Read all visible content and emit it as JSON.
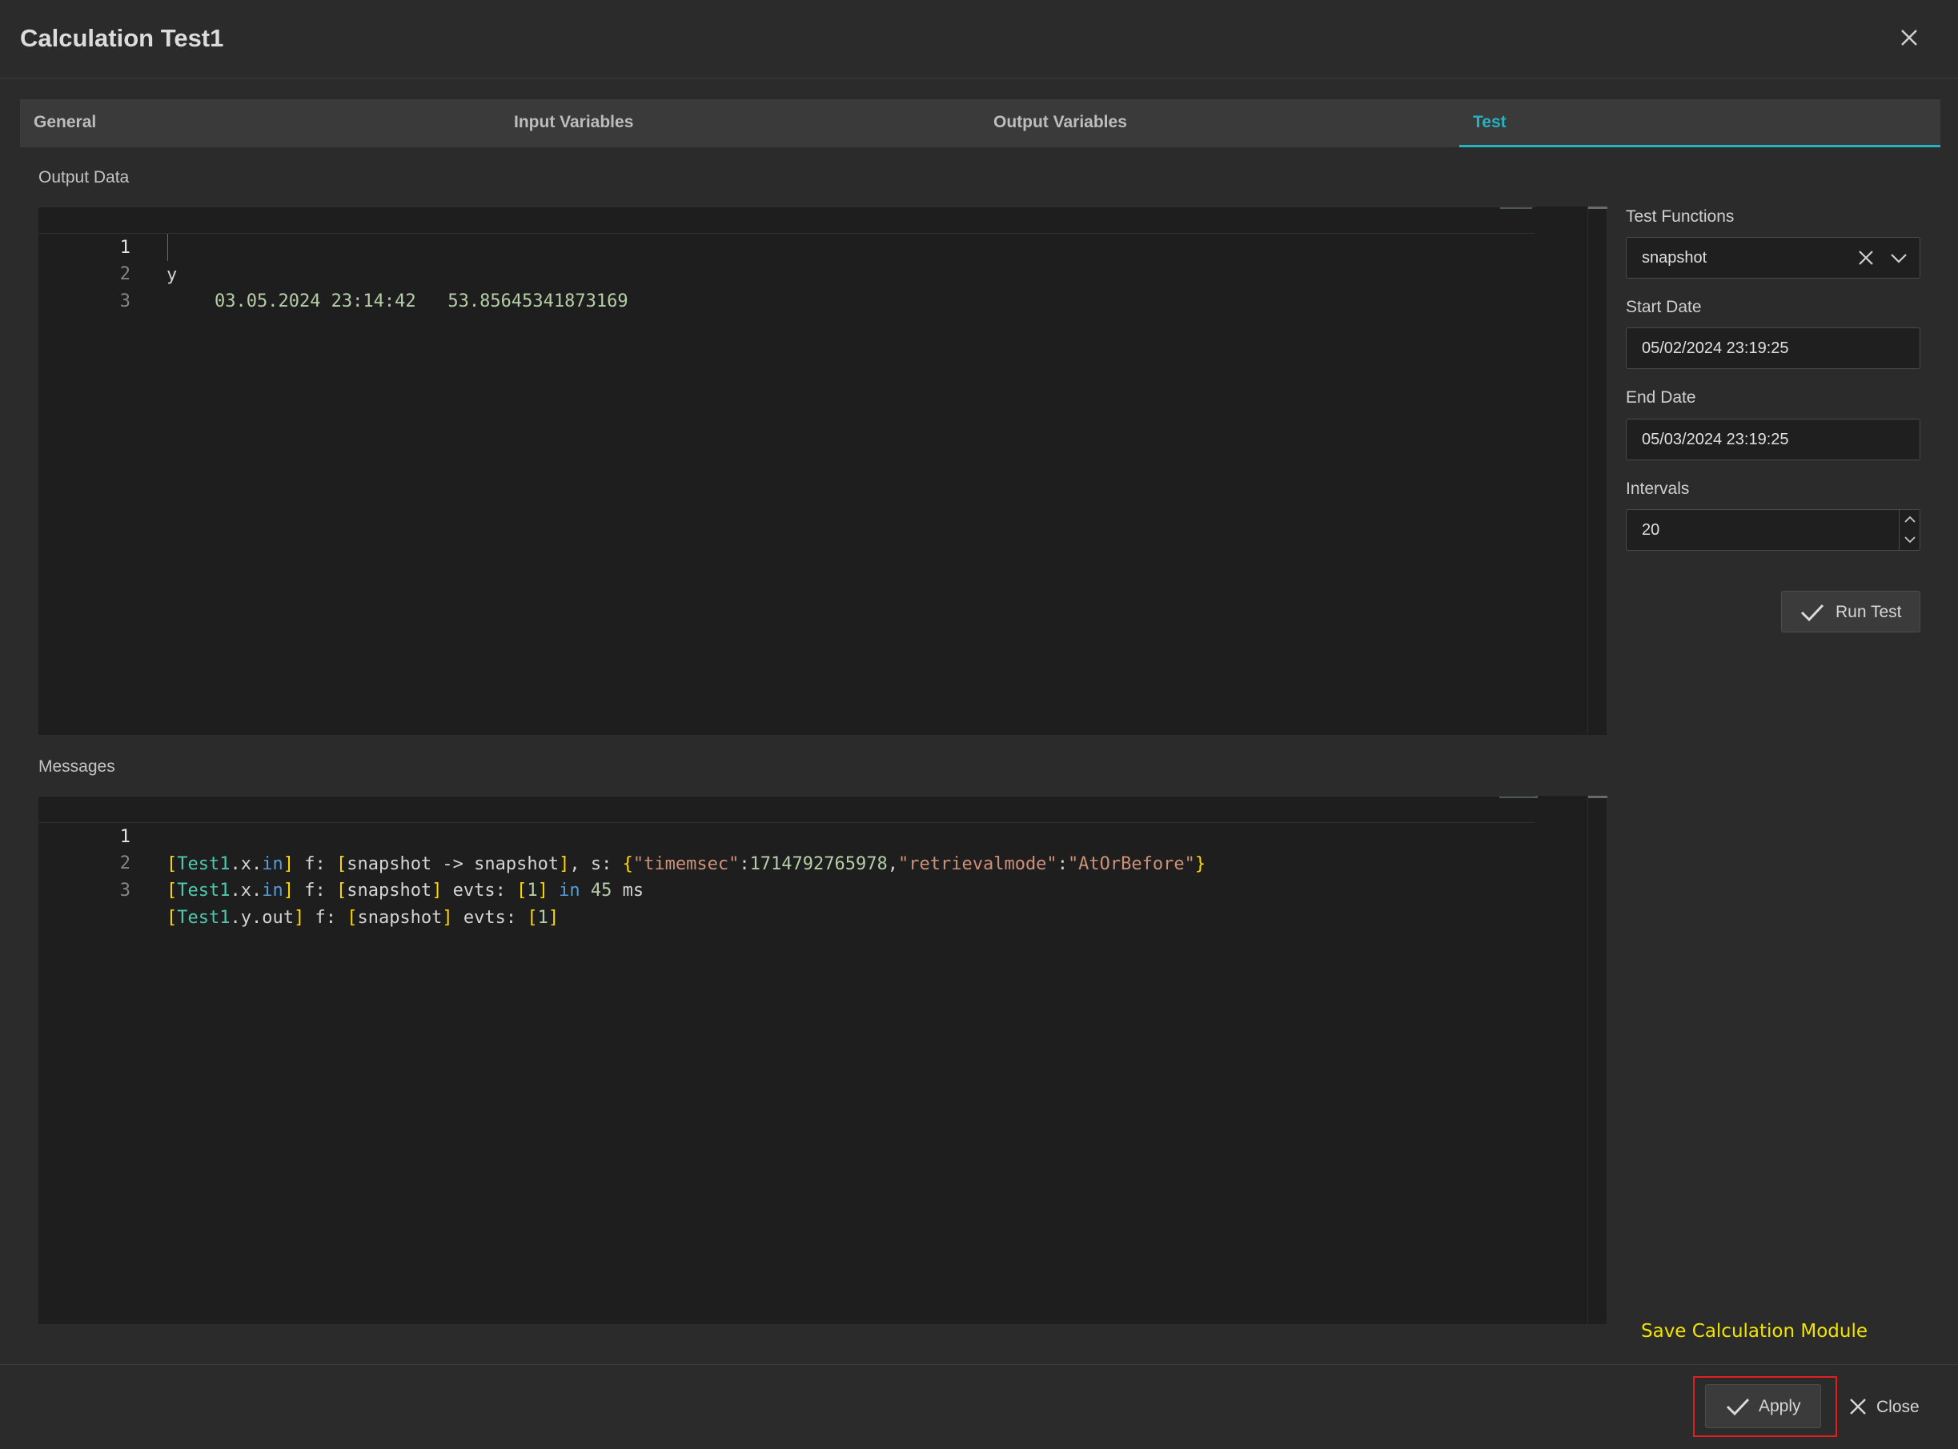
{
  "dialog": {
    "title": "Calculation Test1"
  },
  "tabs": [
    {
      "label": "General"
    },
    {
      "label": "Input Variables"
    },
    {
      "label": "Output Variables"
    },
    {
      "label": "Test",
      "active": true
    }
  ],
  "output": {
    "label": "Output Data",
    "line_numbers": [
      "1",
      "2",
      "3"
    ],
    "lines": [
      {
        "text": "y"
      },
      {
        "date": "03.05.2024 23:14:42",
        "value": "53.85645341873169"
      },
      {
        "text": ""
      }
    ]
  },
  "messages": {
    "label": "Messages",
    "line_numbers": [
      "1",
      "2",
      "3"
    ],
    "line1": {
      "b1": "[",
      "tag1": "Test1",
      "dot1": ".x.",
      "kw1": "in",
      "b2": "]",
      "t1": " f: ",
      "b3": "[",
      "t2": "snapshot -> snapshot",
      "b4": "]",
      "t3": ", s: ",
      "brace_open": "{",
      "k1": "\"timemsec\"",
      "colon1": ":",
      "n1": "1714792765978",
      "comma": ",",
      "k2": "\"retrievalmode\"",
      "colon2": ":",
      "v2": "\"AtOrBefore\"",
      "brace_close": "}"
    },
    "line2": {
      "b1": "[",
      "tag1": "Test1",
      "dot1": ".x.",
      "kw1": "in",
      "b2": "]",
      "t1": " f: ",
      "b3": "[",
      "t2": "snapshot",
      "b4": "]",
      "t3": " evts: ",
      "b5": "[",
      "n1": "1",
      "b6": "]",
      "t4": " ",
      "kw2": "in",
      "t5": " ",
      "n2": "45",
      "t6": " ms"
    },
    "line3": {
      "b1": "[",
      "tag1": "Test1",
      "dot1": ".y.out",
      "b2": "]",
      "t1": " f: ",
      "b3": "[",
      "t2": "snapshot",
      "b4": "]",
      "t3": " evts: ",
      "b5": "[",
      "n1": "1",
      "b6": "]"
    }
  },
  "sidebar": {
    "test_functions": {
      "label": "Test Functions",
      "value": "snapshot"
    },
    "start_date": {
      "label": "Start Date",
      "value": "05/02/2024 23:19:25"
    },
    "end_date": {
      "label": "End Date",
      "value": "05/03/2024 23:19:25"
    },
    "intervals": {
      "label": "Intervals",
      "value": "20"
    },
    "run_test_label": "Run Test"
  },
  "save_link": "Save Calculation Module",
  "footer": {
    "apply_label": "Apply",
    "close_label": "Close"
  },
  "colors": {
    "accent": "#25b3bf",
    "save_link": "#f2e400",
    "highlight": "#e02020"
  }
}
